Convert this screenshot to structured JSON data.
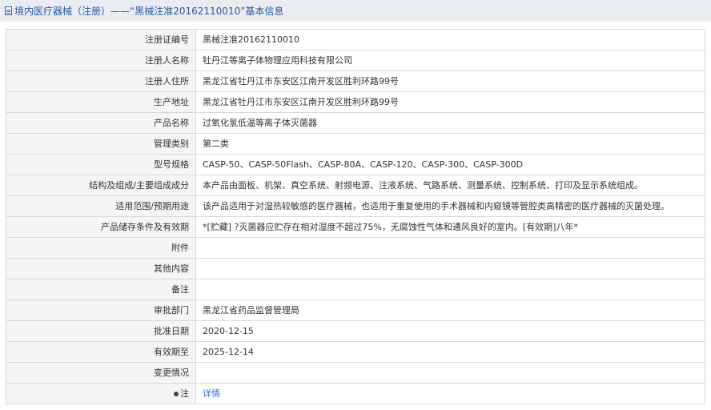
{
  "header": {
    "title": "境内医疗器械（注册）——“黑械注准20162110010”基本信息"
  },
  "rows": [
    {
      "label": "注册证编号",
      "value": "黑械注准20162110010"
    },
    {
      "label": "注册人名称",
      "value": "牡丹江等离子体物理应用科技有限公司"
    },
    {
      "label": "注册人住所",
      "value": "黑龙江省牡丹江市东安区江南开发区胜利环路99号"
    },
    {
      "label": "生产地址",
      "value": "黑龙江省牡丹江市东安区江南开发区胜利环路99号"
    },
    {
      "label": "产品名称",
      "value": "过氧化氢低温等离子体灭菌器"
    },
    {
      "label": "管理类别",
      "value": "第二类"
    },
    {
      "label": "型号规格",
      "value": "CASP-50、CASP-50Flash、CASP-80A、CASP-120、CASP-300、CASP-300D"
    },
    {
      "label": "结构及组成/主要组成成分",
      "value": "本产品由面板、机架、真空系统、射频电源、注液系统、气路系统、测量系统、控制系统、打印及显示系统组成。"
    },
    {
      "label": "适用范围/预期用途",
      "value": "该产品适用于对湿热较敏感的医疗器械，也适用于重复使用的手术器械和内窥镜等管腔类高精密的医疗器械的灭菌处理。"
    },
    {
      "label": "产品储存条件及有效期",
      "value": "*[贮藏] ?灭菌器应贮存在相对湿度不超过75%，无腐蚀性气体和通风良好的室内。[有效期]八年*"
    },
    {
      "label": "附件",
      "value": ""
    },
    {
      "label": "其他内容",
      "value": ""
    },
    {
      "label": "备注",
      "value": ""
    },
    {
      "label": "审批部门",
      "value": "黑龙江省药品监督管理局"
    },
    {
      "label": "批准日期",
      "value": "2020-12-15"
    },
    {
      "label": "有效期至",
      "value": "2025-12-14"
    },
    {
      "label": "变更情况",
      "value": ""
    }
  ],
  "note": {
    "label": "注",
    "icon": "bullet-icon",
    "link_text": "详情"
  }
}
